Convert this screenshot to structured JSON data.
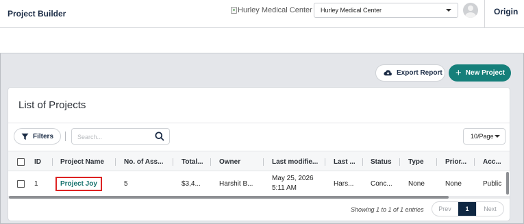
{
  "header": {
    "app_title": "Project Builder",
    "logo_alt": "Hurley Medical Center",
    "org_select_value": "Hurley Medical Center",
    "origin_label": "Origin"
  },
  "actions": {
    "export_label": "Export Report",
    "new_project_label": "New Project",
    "new_project_icon": "+"
  },
  "card": {
    "title": "List of Projects",
    "filters_label": "Filters",
    "search_placeholder": "Search...",
    "page_size_value": "10/Page"
  },
  "table": {
    "columns": [
      "ID",
      "Project Name",
      "No. of Ass...",
      "Total...",
      "Owner",
      "Last modifie...",
      "Last ...",
      "Status",
      "Type",
      "Prior...",
      "Acc..."
    ],
    "rows": [
      {
        "id": "1",
        "project_name": "Project Joy",
        "num_assets": "5",
        "total": "$3,4...",
        "owner": "Harshit B...",
        "last_modified": "May 25, 2026 5:11 AM",
        "last_by": "Hars...",
        "status": "Conc...",
        "type": "None",
        "priority": "None",
        "access": "Public"
      }
    ]
  },
  "pagination": {
    "showing_text": "Showing 1 to 1 of 1 entries",
    "prev_label": "Prev",
    "current_page": "1",
    "next_label": "Next"
  },
  "colors": {
    "accent": "#157f7a",
    "nav_dark": "#0f2742",
    "highlight_border": "#dd2222"
  }
}
